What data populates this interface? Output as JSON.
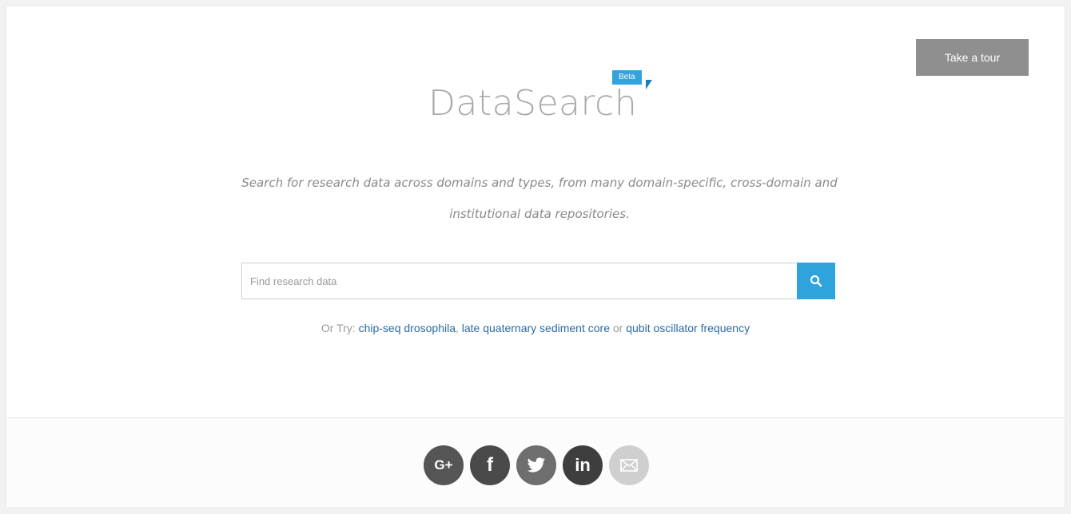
{
  "header": {
    "tour_button": "Take a tour"
  },
  "logo": {
    "text": "DataSearch",
    "badge": "Beta"
  },
  "tagline": {
    "line1": "Search for research data across domains and types, from many domain-specific, cross-domain and",
    "line2": "institutional data repositories."
  },
  "search": {
    "placeholder": "Find research data",
    "value": "",
    "button_icon": "search-icon"
  },
  "suggestions": {
    "prefix": "Or Try: ",
    "items": [
      "chip-seq drosophila",
      "late quaternary sediment core",
      "qubit oscillator frequency"
    ],
    "sep1": ", ",
    "sep2": " or "
  },
  "social": {
    "icons": [
      "google-plus-icon",
      "facebook-icon",
      "twitter-icon",
      "linkedin-icon",
      "email-icon"
    ],
    "gplus_label": "G+",
    "fb_label": "f",
    "in_label": "in"
  },
  "colors": {
    "accent": "#2ea3dc",
    "link": "#2a6aa5",
    "button_gray": "#8f8f8f"
  }
}
